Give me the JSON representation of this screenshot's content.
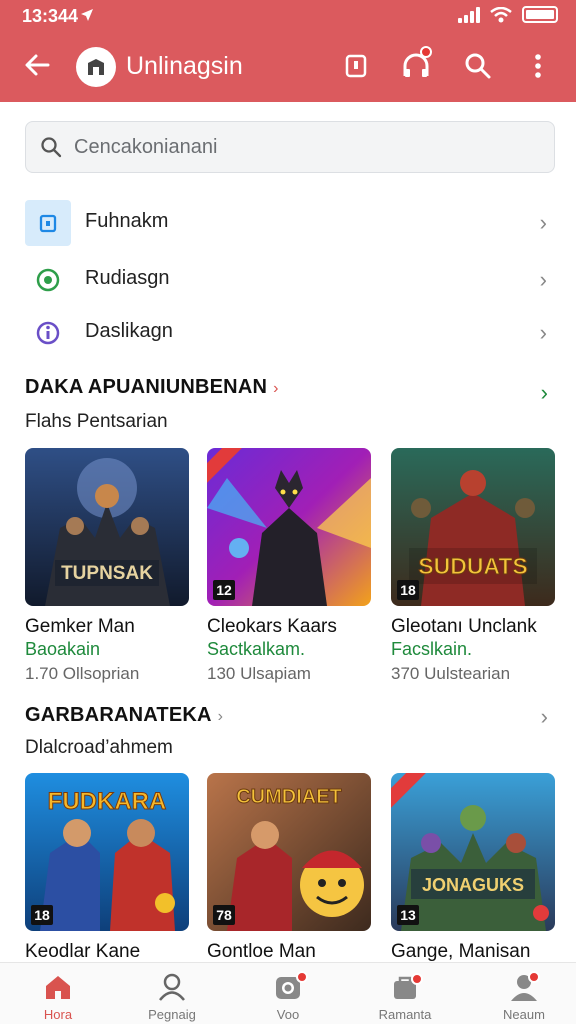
{
  "status_bar": {
    "time": "13:344"
  },
  "header": {
    "title": "Unlinagsin"
  },
  "search": {
    "placeholder": "Cencakonianani"
  },
  "menu": [
    {
      "label": "Fuhnakm",
      "icon": "lock-icon"
    },
    {
      "label": "Rudiasgn",
      "icon": "globe-icon"
    },
    {
      "label": "Daslikagn",
      "icon": "info-icon"
    }
  ],
  "section1": {
    "title": "DAKA APUANIUNBENAN",
    "subtitle": "Flahs Pentsarian",
    "cards": [
      {
        "title": "Gemker Man",
        "subtitle": "Baoakain",
        "meta": "1.70 Ollsoprian",
        "badge": "",
        "art_text": "TUPNSAK"
      },
      {
        "title": "Cleokars Kaars",
        "subtitle": "Sactkalkam.",
        "meta": "130 Ulsapiam",
        "badge": "12",
        "art_text": ""
      },
      {
        "title": "Gleotanı Unclank",
        "subtitle": "Facslkain.",
        "meta": "370 Uulstearian",
        "badge": "18",
        "art_text": "SUDUATS"
      }
    ]
  },
  "section2": {
    "title": "GARBARANATEKA",
    "subtitle": "Dlalcroad’ahmem",
    "cards": [
      {
        "title": "Keodlar Kane",
        "badge": "18",
        "art_text": "FUDKARA"
      },
      {
        "title": "Gontloe Man",
        "badge": "78",
        "art_text": "CUMDIAET"
      },
      {
        "title": "Gange, Manisan",
        "badge": "13",
        "art_text": "JONAGUKS"
      }
    ]
  },
  "bottom_nav": [
    {
      "label": "Hora",
      "icon": "home-icon",
      "active": true
    },
    {
      "label": "Pegnaig",
      "icon": "user-icon",
      "active": false
    },
    {
      "label": "Voo",
      "icon": "camera-icon",
      "active": false
    },
    {
      "label": "Ramanta",
      "icon": "bag-icon",
      "active": false
    },
    {
      "label": "Neaum",
      "icon": "profile-icon",
      "active": false
    }
  ],
  "colors": {
    "header": "#db5a5e",
    "accent": "#d9534f",
    "green": "#1f8a3c"
  }
}
